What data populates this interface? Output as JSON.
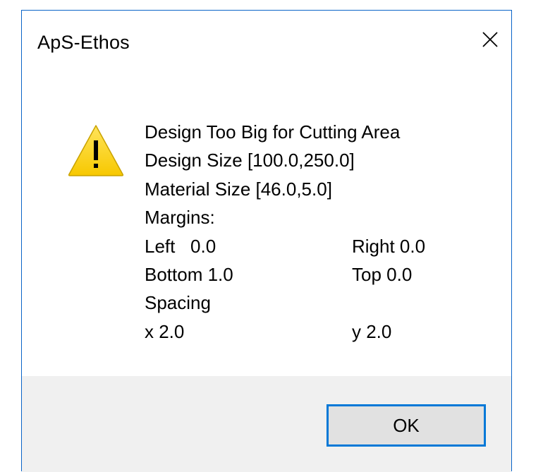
{
  "window": {
    "title": "ApS-Ethos",
    "close_icon": "close-icon"
  },
  "message": {
    "icon": "warning-icon",
    "headline": "Design Too Big for Cutting Area",
    "design_size": "Design Size [100.0,250.0]",
    "material_size": "Material Size [46.0,5.0]",
    "margins_label": "Margins:",
    "left": "Left   0.0",
    "right": "Right 0.0",
    "bottom": "Bottom 1.0",
    "top": "Top 0.0",
    "spacing_label": "Spacing",
    "x": "x 2.0",
    "y": "y 2.0"
  },
  "buttons": {
    "ok_label": "OK"
  },
  "colors": {
    "accent": "#0078d7",
    "warning_fill": "#fcd116",
    "footer_bg": "#f0f0f0"
  }
}
